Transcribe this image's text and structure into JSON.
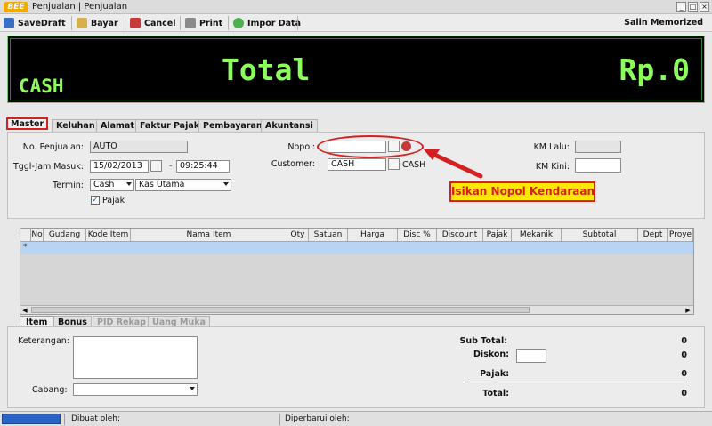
{
  "window": {
    "logo": "BEE",
    "title": "Penjualan | Penjualan",
    "controls": [
      "_",
      "□",
      "×"
    ]
  },
  "toolbar": {
    "savedraft": "SaveDraft",
    "bayar": "Bayar",
    "cancel": "Cancel",
    "print": "Print",
    "impor": "Impor Data",
    "salin": "Salin Memorized"
  },
  "display": {
    "payment": "CASH",
    "label": "Total",
    "amount": "Rp.0"
  },
  "tabs": [
    "Master",
    "Keluhan",
    "Alamat",
    "Faktur Pajak",
    "Pembayaran",
    "Akuntansi"
  ],
  "form": {
    "no_label": "No. Penjualan:",
    "no_value": "AUTO",
    "tggl_label": "Tggl-Jam Masuk:",
    "date": "15/02/2013",
    "dash": "-",
    "time": "09:25:44",
    "termin_label": "Termin:",
    "termin": "Cash",
    "kas": "Kas Utama",
    "pajak_label": "Pajak",
    "pajak_checked": true,
    "nopol_label": "Nopol:",
    "nopol_value": "",
    "customer_label": "Customer:",
    "customer_value": "CASH",
    "customer_name": "CASH",
    "km_lalu_label": "KM Lalu:",
    "km_kini_label": "KM Kini:"
  },
  "callout": "Isikan Nopol Kendaraan",
  "grid": {
    "columns": [
      "No",
      "Gudang",
      "Kode Item",
      "Nama Item",
      "Qty",
      "Satuan",
      "Harga",
      "Disc %",
      "Discount",
      "Pajak",
      "Mekanik",
      "Subtotal",
      "Dept",
      "Proye"
    ],
    "row_marker": "*"
  },
  "bottom_tabs": [
    "Item",
    "Bonus",
    "PID Rekap",
    "Uang Muka"
  ],
  "bottom": {
    "keterangan_label": "Keterangan:",
    "cabang_label": "Cabang:",
    "subtotal_label": "Sub Total:",
    "subtotal_value": "0",
    "diskon_label": "Diskon:",
    "diskon_value": "0",
    "pajak_label": "Pajak:",
    "pajak_value": "0",
    "total_label": "Total:",
    "total_value": "0"
  },
  "status": {
    "dibuat": "Dibuat oleh:",
    "diperbarui": "Diperbarui oleh:"
  },
  "colors": {
    "display_text": "#8cff5a",
    "highlight": "#d42020",
    "callout_bg": "#ffe800",
    "grid_row": "#b8d4f2"
  }
}
